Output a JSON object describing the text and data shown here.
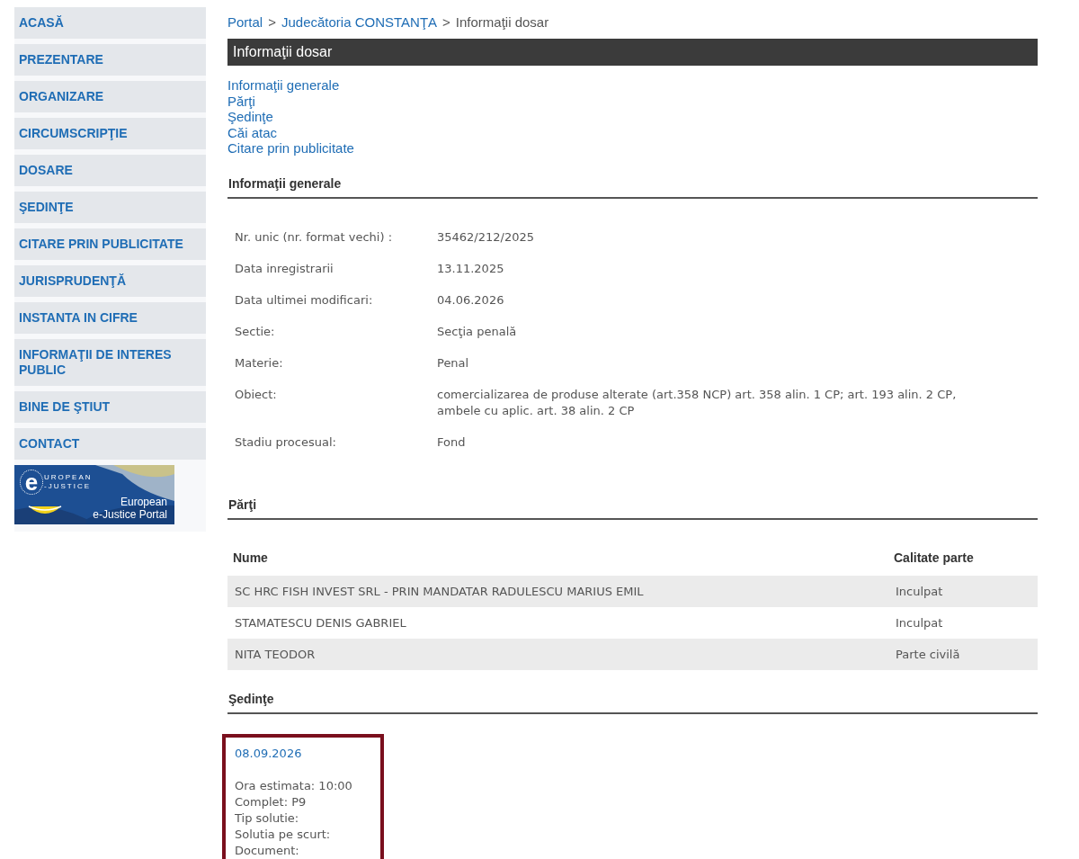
{
  "sidebar": {
    "items": [
      {
        "label": "ACASĂ"
      },
      {
        "label": "PREZENTARE"
      },
      {
        "label": "ORGANIZARE"
      },
      {
        "label": "CIRCUMSCRIPŢIE"
      },
      {
        "label": "DOSARE"
      },
      {
        "label": "ŞEDINŢE"
      },
      {
        "label": "CITARE PRIN PUBLICITATE"
      },
      {
        "label": "JURISPRUDENŢĂ"
      },
      {
        "label": "INSTANTA IN CIFRE"
      },
      {
        "label": "INFORMAŢII DE INTERES PUBLIC"
      },
      {
        "label": "BINE DE ŞTIUT"
      },
      {
        "label": "CONTACT"
      }
    ],
    "banner": {
      "logo_letter": "e",
      "logo_top": "UROPEAN",
      "logo_bottom": "-JUSTICE",
      "lines": [
        "European",
        "e-Justice Portal"
      ]
    }
  },
  "breadcrumb": [
    {
      "label": "Portal",
      "link": true
    },
    {
      "label": "Judecătoria CONSTANŢA",
      "link": true
    },
    {
      "label": "Informaţii dosar",
      "link": false
    }
  ],
  "breadcrumb_separator": ">",
  "page_title": "Informaţii dosar",
  "section_links": [
    "Informaţii generale",
    "Părţi",
    "Şedinţe",
    "Căi atac",
    "Citare prin publicitate"
  ],
  "general": {
    "title": "Informaţii generale",
    "rows": [
      {
        "label": "Nr. unic (nr. format vechi) :",
        "value": "35462/212/2025"
      },
      {
        "label": "Data inregistrarii",
        "value": "13.11.2025"
      },
      {
        "label": "Data ultimei modificari:",
        "value": "04.06.2026"
      },
      {
        "label": "Sectie:",
        "value": "Secţia penală"
      },
      {
        "label": "Materie:",
        "value": "Penal"
      },
      {
        "label": "Obiect:",
        "value": "comercializarea de produse alterate (art.358 NCP) art. 358 alin. 1 CP; art. 193 alin. 2 CP, ambele cu aplic. art. 38 alin. 2 CP"
      },
      {
        "label": "Stadiu procesual:",
        "value": "Fond"
      }
    ]
  },
  "parties": {
    "title": "Părţi",
    "columns": [
      "Nume",
      "Calitate parte"
    ],
    "rows": [
      [
        "SC HRC FISH INVEST SRL - PRIN MANDATAR RADULESCU MARIUS EMIL",
        "Inculpat"
      ],
      [
        "STAMATESCU DENIS GABRIEL",
        "Inculpat"
      ],
      [
        "NITA TEODOR",
        "Parte civilă"
      ]
    ]
  },
  "hearings": {
    "title": "Şedinţe",
    "items": [
      {
        "date": "08.09.2026",
        "lines": [
          "Ora estimata: 10:00",
          "Complet: P9",
          "Tip solutie:",
          "Solutia pe scurt:",
          "Document:"
        ]
      }
    ]
  }
}
